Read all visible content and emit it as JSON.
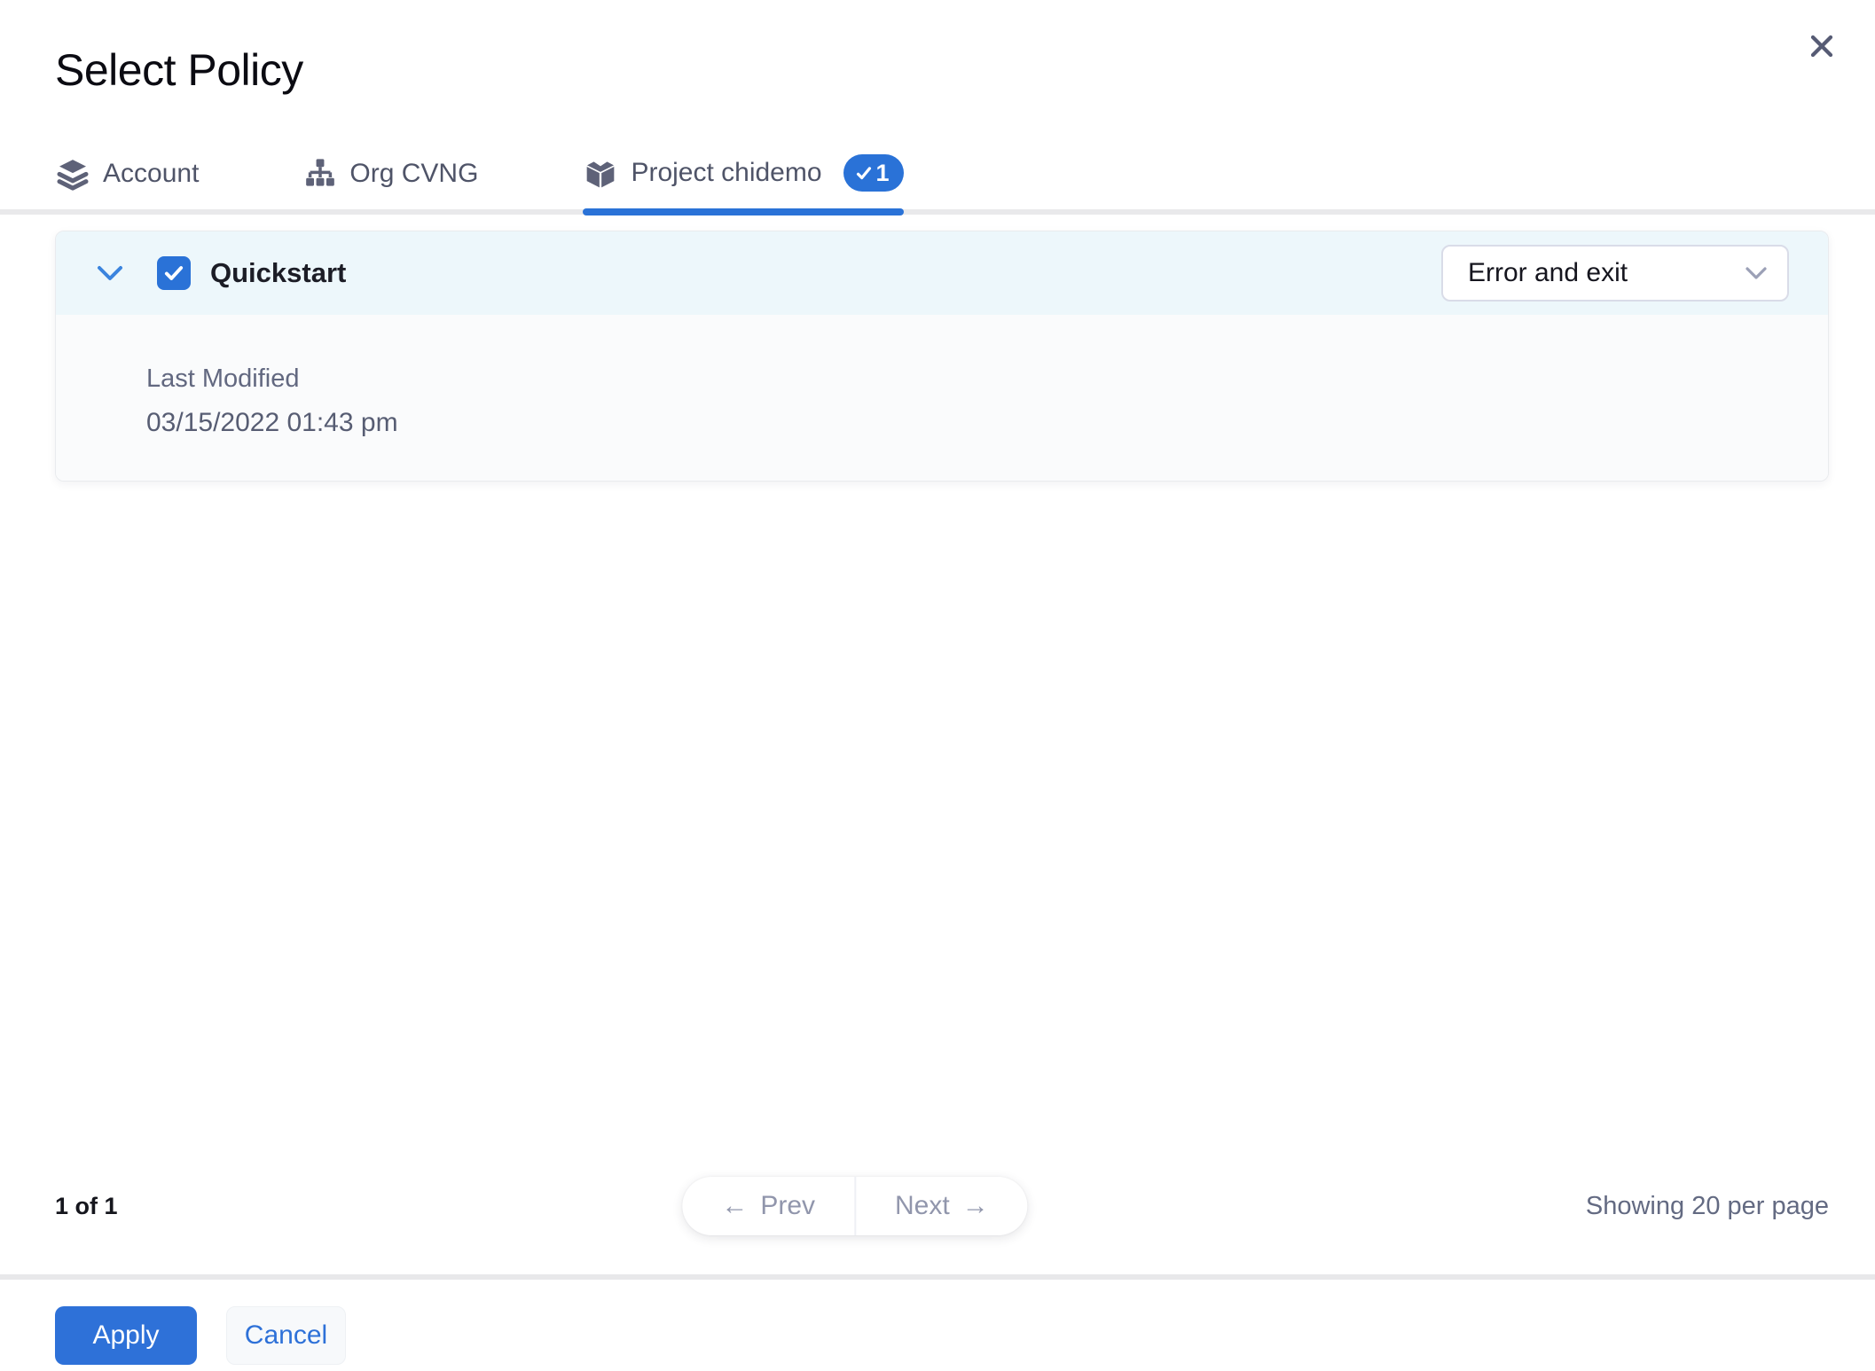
{
  "dialog": {
    "title": "Select Policy",
    "close_icon": "close-icon"
  },
  "tabs": [
    {
      "label": "Account",
      "icon": "layers-icon",
      "active": false
    },
    {
      "label": "Org CVNG",
      "icon": "org-hierarchy-icon",
      "active": false
    },
    {
      "label": "Project chidemo",
      "icon": "cube-icon",
      "active": true,
      "badge": {
        "icon": "check-icon",
        "count": "1"
      }
    }
  ],
  "policy_row": {
    "name": "Quickstart",
    "checkbox_checked": true,
    "expand_icon": "chevron-down-icon",
    "action_select": {
      "value": "Error and exit",
      "caret_icon": "chevron-down-icon"
    },
    "details": {
      "label": "Last Modified",
      "value": "03/15/2022 01:43 pm"
    }
  },
  "pagination": {
    "page_info": "1 of 1",
    "prev_arrow": "←",
    "prev_label": "Prev",
    "next_label": "Next",
    "next_arrow": "→",
    "showing": "Showing 20 per page"
  },
  "footer": {
    "apply_label": "Apply",
    "cancel_label": "Cancel"
  },
  "colors": {
    "accent_blue": "#2a72d7",
    "apply_blue": "#2e71d8",
    "panel_header_bg": "#edf7fb",
    "panel_body_bg": "#fafbfc",
    "divider_gray": "#e8e8ea",
    "tab_text": "#4f5468",
    "muted_text": "#626880",
    "pager_text": "#9196ac"
  }
}
